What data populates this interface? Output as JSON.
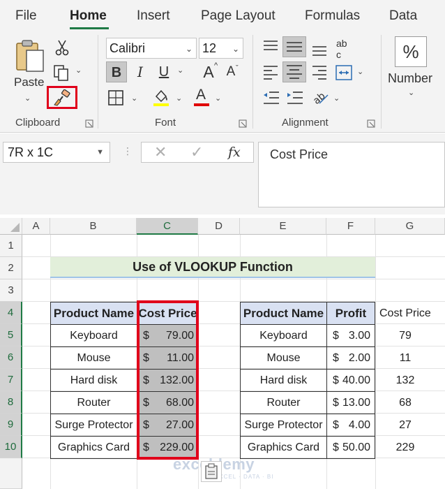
{
  "ribbon_tabs": [
    "File",
    "Home",
    "Insert",
    "Page Layout",
    "Formulas",
    "Data"
  ],
  "active_tab": "Home",
  "clipboard": {
    "paste_label": "Paste",
    "group_label": "Clipboard",
    "icons": [
      "paste-icon",
      "cut-icon",
      "copy-icon",
      "format-painter-icon"
    ]
  },
  "font": {
    "family": "Calibri",
    "size": "12",
    "bold": "B",
    "italic": "I",
    "underline": "U",
    "grow": "A",
    "shrink": "A",
    "group_label": "Font"
  },
  "alignment": {
    "group_label": "Alignment",
    "wrap_glyph": "ab c"
  },
  "number": {
    "format_glyph": "%",
    "group_label": "Number"
  },
  "formula_bar": {
    "name_box": "7R x 1C",
    "cancel": "✕",
    "enter": "✓",
    "fx": "fx",
    "content": "Cost Price"
  },
  "sheet": {
    "columns": [
      "A",
      "B",
      "C",
      "D",
      "E",
      "F",
      "G"
    ],
    "rows": [
      "1",
      "2",
      "3",
      "4",
      "5",
      "6",
      "7",
      "8",
      "9",
      "10"
    ],
    "title": "Use of VLOOKUP Function",
    "left_table": {
      "headers": [
        "Product Name",
        "Cost Price"
      ],
      "rows": [
        {
          "product": "Keyboard",
          "currency": "$",
          "cost": "79.00"
        },
        {
          "product": "Mouse",
          "currency": "$",
          "cost": "11.00"
        },
        {
          "product": "Hard disk",
          "currency": "$",
          "cost": "132.00"
        },
        {
          "product": "Router",
          "currency": "$",
          "cost": "68.00"
        },
        {
          "product": "Surge Protector",
          "currency": "$",
          "cost": "27.00"
        },
        {
          "product": "Graphics Card",
          "currency": "$",
          "cost": "229.00"
        }
      ]
    },
    "right_table": {
      "headers": [
        "Product Name",
        "Profit"
      ],
      "rows": [
        {
          "product": "Keyboard",
          "currency": "$",
          "profit": "3.00"
        },
        {
          "product": "Mouse",
          "currency": "$",
          "profit": "2.00"
        },
        {
          "product": "Hard disk",
          "currency": "$",
          "profit": "40.00"
        },
        {
          "product": "Router",
          "currency": "$",
          "profit": "13.00"
        },
        {
          "product": "Surge Protector",
          "currency": "$",
          "profit": "4.00"
        },
        {
          "product": "Graphics Card",
          "currency": "$",
          "profit": "50.00"
        }
      ]
    },
    "pasted_column": {
      "header": "Cost Price",
      "values": [
        "79",
        "11",
        "132",
        "68",
        "27",
        "229"
      ]
    }
  },
  "watermark": {
    "name": "exceldemy",
    "sub": "EXCEL · DATA · BI"
  },
  "colors": {
    "accent": "#1f7a45",
    "highlight": "#e0001b",
    "header_fill": "#d9e1f2",
    "title_fill": "#e2efda"
  }
}
